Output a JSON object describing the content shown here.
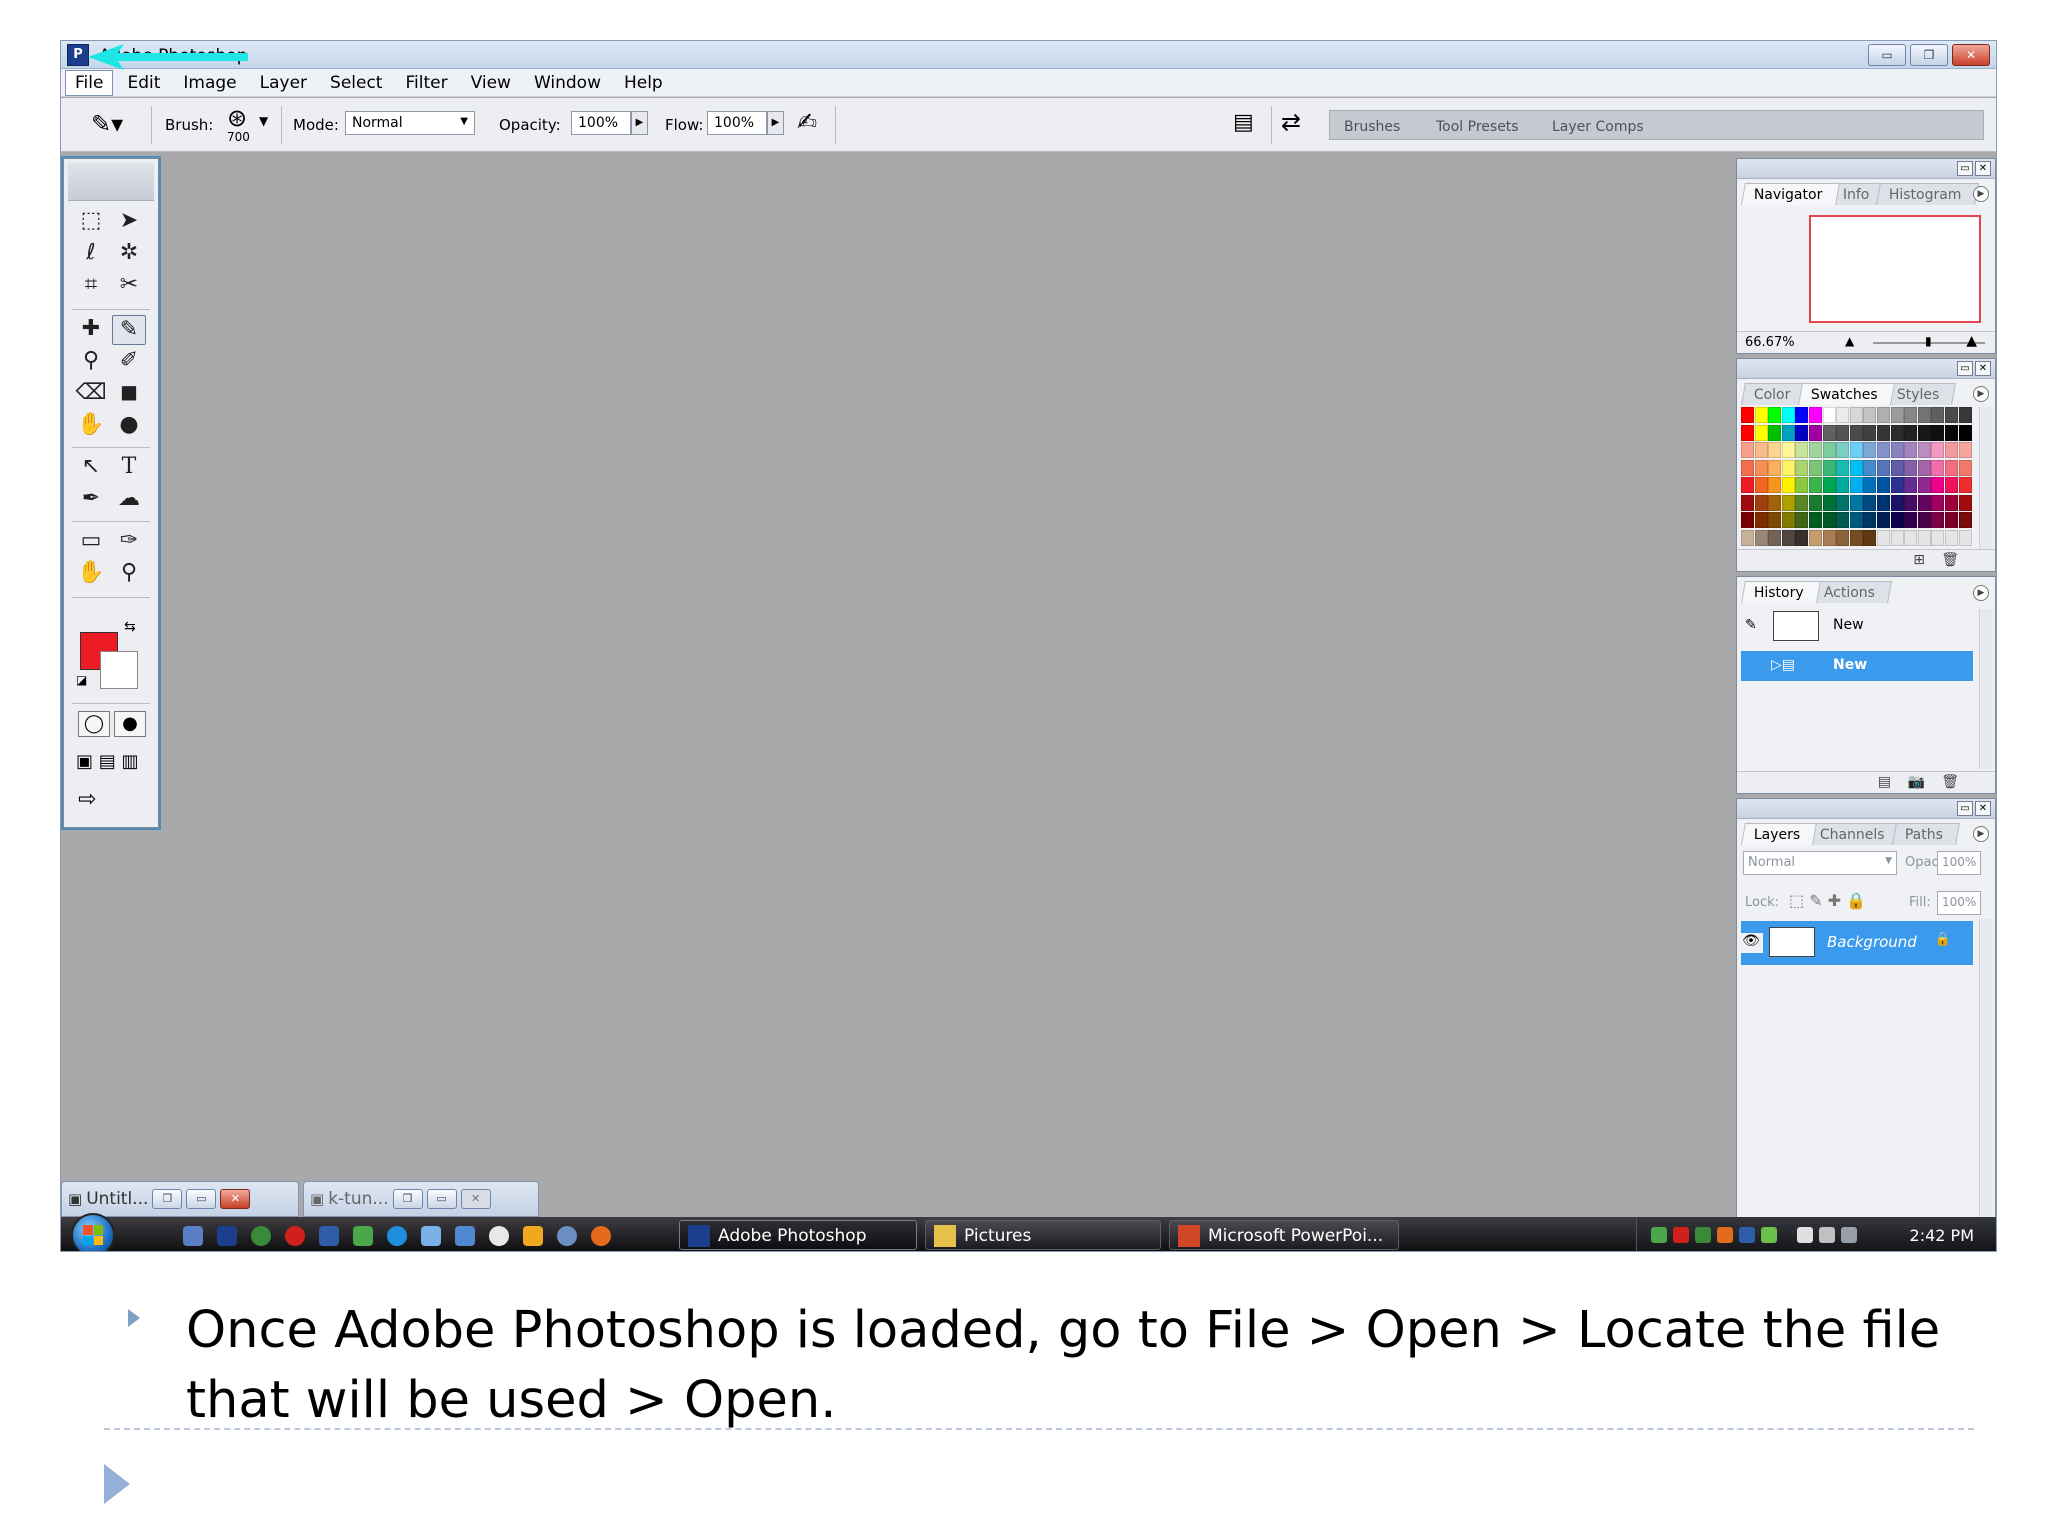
{
  "window": {
    "title": "Adobe Photoshop",
    "min": "▭",
    "max": "❐",
    "close": "✕"
  },
  "menu": [
    "File",
    "Edit",
    "Image",
    "Layer",
    "Select",
    "Filter",
    "View",
    "Window",
    "Help"
  ],
  "options": {
    "brush_label": "Brush:",
    "brush_size": "700",
    "mode_label": "Mode:",
    "mode_value": "Normal",
    "opacity_label": "Opacity:",
    "opacity_value": "100%",
    "flow_label": "Flow:",
    "flow_value": "100%",
    "well_tabs": [
      "Brushes",
      "Tool Presets",
      "Layer Comps"
    ]
  },
  "navigator": {
    "tabs": [
      "Navigator",
      "Info",
      "Histogram"
    ],
    "zoom": "66.67%"
  },
  "swatches_panel": {
    "tabs": [
      "Color",
      "Swatches",
      "Styles"
    ],
    "row_colors": [
      [
        "#ff0000",
        "#ffff00",
        "#00ff00",
        "#00ffff",
        "#0000ff",
        "#ff00ff",
        "#ffffff",
        "#ebebeb",
        "#d7d7d7",
        "#c3c3c3",
        "#afafaf",
        "#9b9b9b",
        "#878787",
        "#737373",
        "#5f5f5f",
        "#4b4b4b",
        "#373737"
      ],
      [
        "#ff0000",
        "#ffff00",
        "#00c000",
        "#00a0c0",
        "#0000c0",
        "#a000a0",
        "#606060",
        "#545454",
        "#4a4a4a",
        "#404040",
        "#363636",
        "#2c2c2c",
        "#222222",
        "#181818",
        "#101010",
        "#080808",
        "#000000"
      ],
      [
        "#f7a08c",
        "#f9ba8c",
        "#fdd58c",
        "#fff799",
        "#c8e39c",
        "#a3d39c",
        "#7fcba0",
        "#7ccdc7",
        "#6ccff6",
        "#7ea7d8",
        "#8393ca",
        "#8882be",
        "#a186be",
        "#bd8cbf",
        "#f49ac1",
        "#f5989d",
        "#f6a69a"
      ],
      [
        "#f26c4f",
        "#f68e55",
        "#fbaf5c",
        "#fff467",
        "#acd372",
        "#7cc576",
        "#3bb878",
        "#1abbb4",
        "#00bff3",
        "#438ccb",
        "#5574b9",
        "#605ca8",
        "#855fa8",
        "#a763a8",
        "#f06ea9",
        "#f26d7d",
        "#f2786c"
      ],
      [
        "#ed1c24",
        "#f26522",
        "#f7941d",
        "#fff200",
        "#8dc63f",
        "#39b54a",
        "#00a651",
        "#00a99d",
        "#00aeef",
        "#0072bc",
        "#0054a6",
        "#2e3192",
        "#662d91",
        "#92278f",
        "#ec008c",
        "#ed145b",
        "#ee2e2e"
      ],
      [
        "#9e0b0f",
        "#a0410d",
        "#a36209",
        "#aba000",
        "#598527",
        "#1a7b30",
        "#007236",
        "#00746b",
        "#0076a3",
        "#004b80",
        "#003471",
        "#1b1464",
        "#440e62",
        "#630460",
        "#9e005d",
        "#9e0039",
        "#a00c0c"
      ],
      [
        "#790000",
        "#7b2e00",
        "#7d4900",
        "#827b00",
        "#406618",
        "#005e20",
        "#005826",
        "#005952",
        "#005b7f",
        "#003663",
        "#002157",
        "#0d004c",
        "#32004b",
        "#4b0049",
        "#7b0046",
        "#7a0026",
        "#7b0a0a"
      ],
      [
        "#c7b299",
        "#998675",
        "#736357",
        "#534741",
        "#37302d",
        "#c69c6d",
        "#a67c52",
        "#8c6239",
        "#754c24",
        "#603913",
        "#e5e5e5",
        "#e5e5e5",
        "#e5e5e5",
        "#e5e5e5",
        "#e5e5e5",
        "#e5e5e5",
        "#e5e5e5"
      ]
    ]
  },
  "history": {
    "tabs": [
      "History",
      "Actions"
    ],
    "rows": [
      "New",
      "New"
    ]
  },
  "layers": {
    "tabs": [
      "Layers",
      "Channels",
      "Paths"
    ],
    "blend": "Normal",
    "opacity_label": "Opacity:",
    "opacity_value": "100%",
    "lock_label": "Lock:",
    "fill_label": "Fill:",
    "fill_value": "100%",
    "layer_name": "Background"
  },
  "docs": [
    {
      "label": "Untitl..."
    },
    {
      "label": "k-tun..."
    }
  ],
  "taskbar": {
    "tasks": [
      "Adobe Photoshop",
      "Pictures",
      "Microsoft PowerPoi..."
    ],
    "clock": "2:42 PM"
  },
  "slide": {
    "bullet1": "Once Adobe Photoshop is loaded, go to File > Open > Locate the file that will be used > Open."
  },
  "colors": {
    "accent_cyan": "#1ee6e6",
    "selection_blue": "#3b9aeb",
    "foreground": "#ed1c24",
    "background": "#ffffff"
  }
}
